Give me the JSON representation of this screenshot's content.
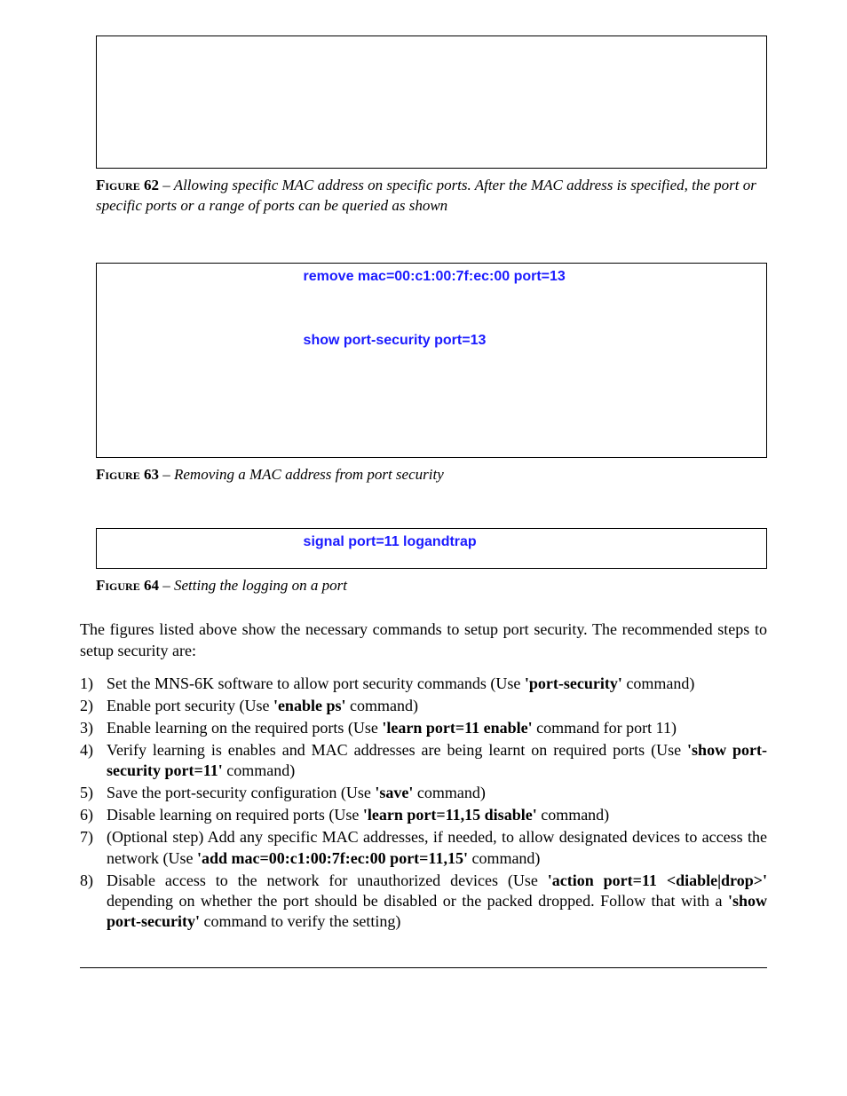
{
  "figure62": {
    "label": "Figure 62",
    "desc": "Allowing specific MAC address on specific ports. After the MAC address is specified, the port or specific ports or a range of ports can be queried as shown"
  },
  "figure63": {
    "box": {
      "line1_cmd": "remove mac=00:c1:00:7f:ec:00 port=13",
      "line2_cmd": "show port-security port=13"
    },
    "label": "Figure 63",
    "desc": "Removing a MAC address from port security"
  },
  "figure64": {
    "box": {
      "line1_cmd": "signal port=11 logandtrap"
    },
    "label": "Figure 64",
    "desc": "Setting the logging on a port"
  },
  "intro": "The figures listed above show the necessary commands to setup port security. The recommended steps to setup security are:",
  "steps": {
    "s1_a": "Set the MNS-6K software to allow port security commands (Use ",
    "s1_b": "'port-security'",
    "s1_c": " command)",
    "s2_a": "Enable port security (Use ",
    "s2_b": "'enable ps'",
    "s2_c": " command)",
    "s3_a": "Enable learning on the required ports (Use ",
    "s3_b": "'learn   port=11 enable'",
    "s3_c": " command for port 11)",
    "s4_a": "Verify learning is enables and MAC addresses are being learnt on required ports (Use ",
    "s4_b": "'show port-security port=11'",
    "s4_c": " command)",
    "s5_a": "Save the port-security configuration (Use ",
    "s5_b": "'save'",
    "s5_c": " command)",
    "s6_a": "Disable learning on required ports (Use ",
    "s6_b": "'learn port=11,15 disable'",
    "s6_c": " command)",
    "s7_a": "(Optional step) Add any specific MAC addresses, if needed, to allow designated devices to access the network (Use ",
    "s7_b": "'add mac=00:c1:00:7f:ec:00 port=11,15'",
    "s7_c": " command)",
    "s8_a": "Disable access to the network for unauthorized devices (Use ",
    "s8_b": "'action port=11 <diable|drop>'",
    "s8_c": " depending on whether the port should be disabled or the packed dropped. Follow that with a ",
    "s8_d": "'show port-security'",
    "s8_e": " command to verify the setting)"
  }
}
